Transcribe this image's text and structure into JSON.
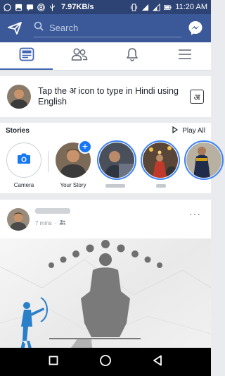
{
  "status_bar": {
    "speed": "7.97KB/s",
    "time": "11:20 AM"
  },
  "search": {
    "placeholder": "Search"
  },
  "nav_tabs": [
    {
      "icon": "news-feed-icon",
      "active": true
    },
    {
      "icon": "friends-icon",
      "active": false
    },
    {
      "icon": "notifications-bell-icon",
      "active": false
    },
    {
      "icon": "menu-icon",
      "active": false
    }
  ],
  "composer": {
    "prompt": "Tap the अ icon to type in Hindi using English",
    "hindi_key": "अ"
  },
  "stories": {
    "title": "Stories",
    "play_all": "Play All",
    "camera_label": "Camera",
    "your_story_label": "Your Story",
    "add_badge": "+"
  },
  "post": {
    "time": "7 mins",
    "more": "···"
  },
  "colors": {
    "brand": "#3b5998",
    "status": "#2d4373",
    "accent": "#1877f2"
  }
}
